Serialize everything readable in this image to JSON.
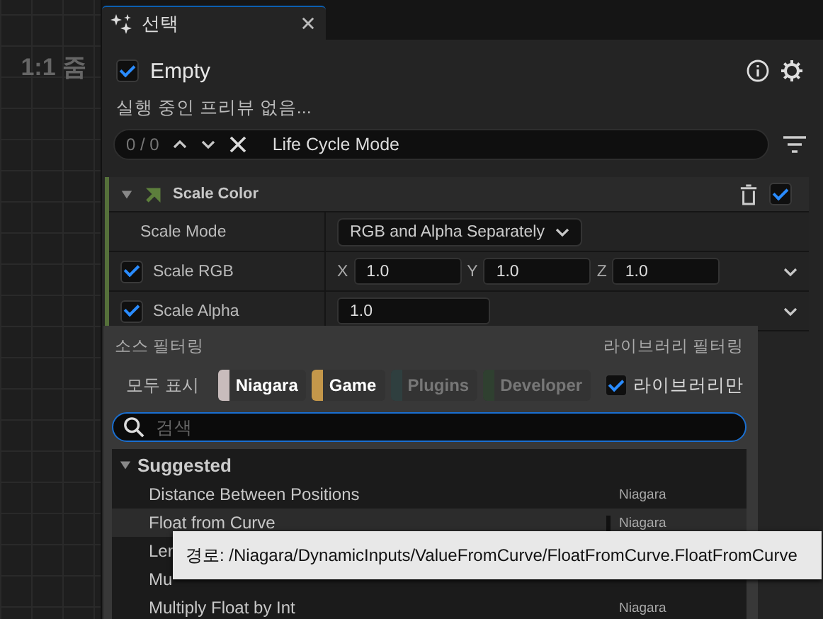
{
  "viewport": {
    "zoom_label": "1:1 줌"
  },
  "tab": {
    "title": "선택",
    "selected": true
  },
  "emitter": {
    "name": "Empty",
    "enabled": true,
    "status": "실행 중인 프리뷰 없음..."
  },
  "search": {
    "count": "0 / 0",
    "value": "Life Cycle Mode"
  },
  "module": {
    "title": "Scale Color",
    "expanded": true,
    "enabled": true,
    "properties": [
      {
        "kind": "dropdown",
        "label": "Scale Mode",
        "value": "RGB and Alpha Separately"
      },
      {
        "kind": "vector",
        "label": "Scale RGB",
        "checked": true,
        "fields": [
          {
            "axis": "X",
            "value": "1.0"
          },
          {
            "axis": "Y",
            "value": "1.0"
          },
          {
            "axis": "Z",
            "value": "1.0"
          }
        ]
      },
      {
        "kind": "scalar",
        "label": "Scale Alpha",
        "checked": true,
        "value": "1.0"
      }
    ]
  },
  "menu": {
    "source_filter_label": "소스 필터링",
    "library_filter_label": "라이브러리 필터링",
    "show_all": "모두 표시",
    "sources": [
      {
        "label": "Niagara",
        "on": true,
        "color": "#c8bcbc"
      },
      {
        "label": "Game",
        "on": true,
        "color": "#c4974a"
      },
      {
        "label": "Plugins",
        "on": false,
        "color": "#2f3f3f"
      },
      {
        "label": "Developer",
        "on": false,
        "color": "#2f4030"
      }
    ],
    "library_only": {
      "label": "라이브러리만",
      "checked": true
    },
    "search": {
      "placeholder": "검색"
    },
    "category": {
      "title": "Suggested",
      "expanded": true,
      "items": [
        {
          "label": "Distance Between Positions",
          "source": "Niagara",
          "selected": false
        },
        {
          "label": "Float from Curve",
          "source": "Niagara",
          "selected": true
        },
        {
          "label": "Ler",
          "selected": false
        },
        {
          "label": "Mu",
          "selected": false
        },
        {
          "label": "Multiply Float by Int",
          "source": "Niagara",
          "selected": false
        }
      ]
    }
  },
  "tooltip": {
    "text": "경로: /Niagara/DynamicInputs/ValueFromCurve/FloatFromCurve.FloatFromCurve"
  }
}
